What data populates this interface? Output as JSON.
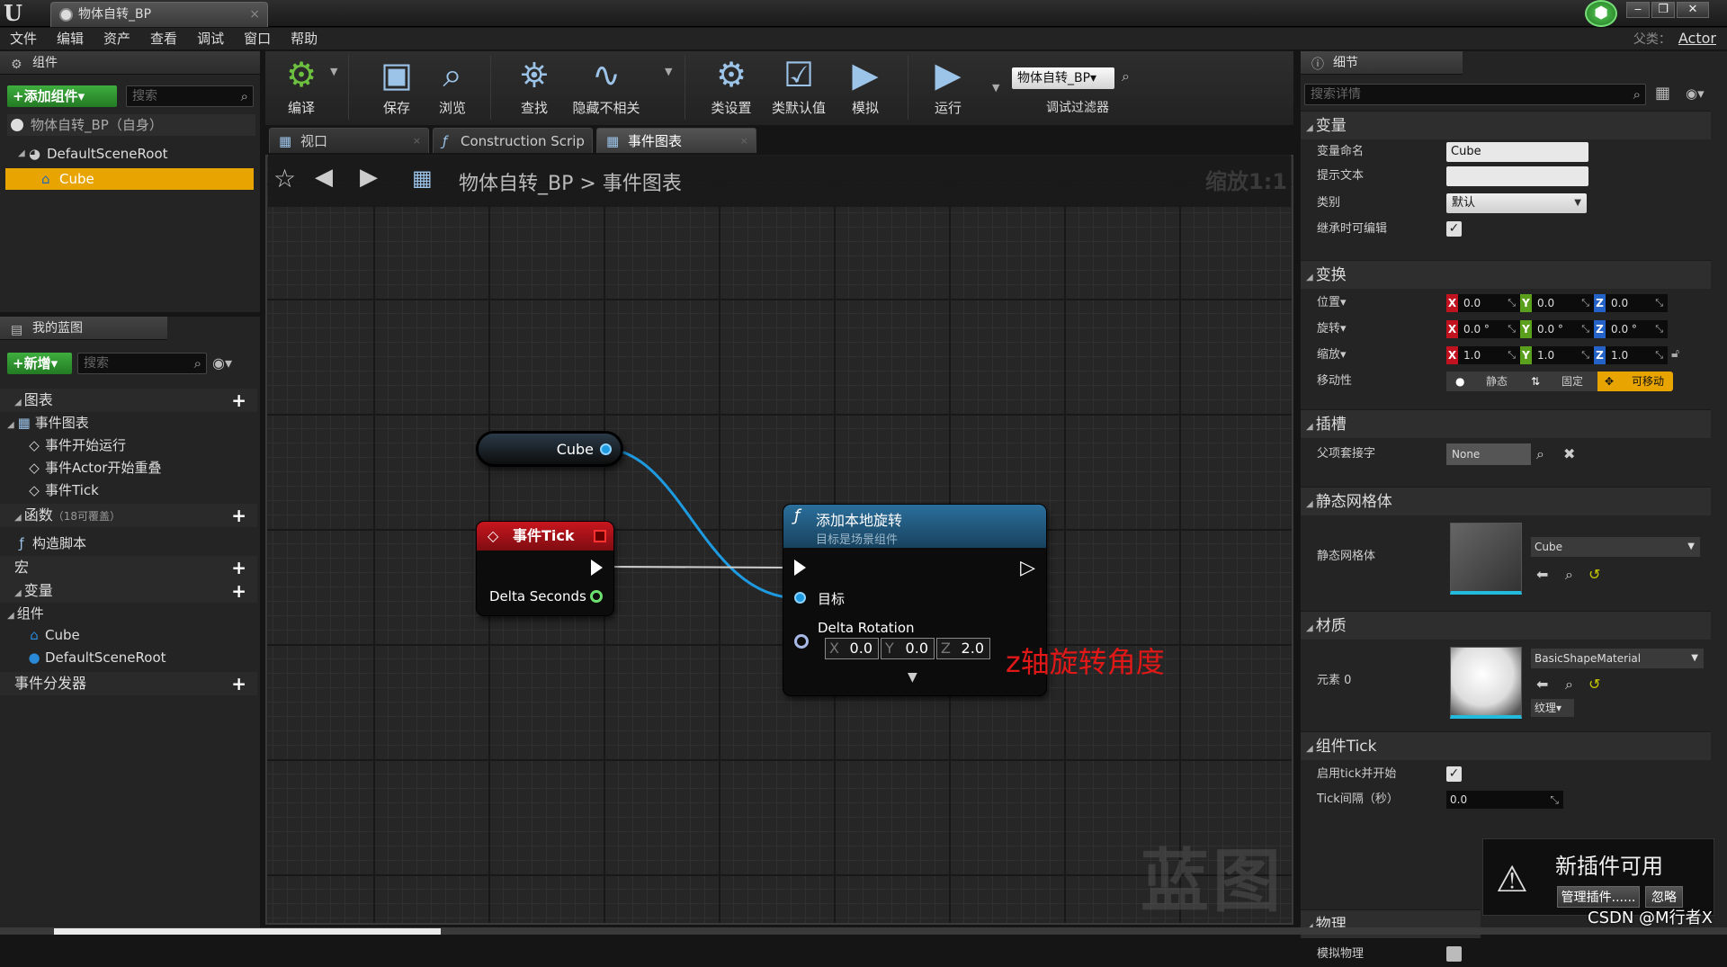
{
  "window": {
    "tab_title": "物体自转_BP",
    "tab_close": "×",
    "logo": "U",
    "min": "‒",
    "max": "❐",
    "close": "✕",
    "shield_icon": "shield-icon"
  },
  "menu": [
    "文件",
    "编辑",
    "资产",
    "查看",
    "调试",
    "窗口",
    "帮助"
  ],
  "parent_class": {
    "label": "父类：",
    "value": "Actor"
  },
  "components_panel": {
    "title": "组件",
    "add_button": "+添加组件▾",
    "search_placeholder": "搜索",
    "self_item": "物体自转_BP（自身）",
    "root_item": "DefaultSceneRoot",
    "selected_item": "Cube"
  },
  "my_blueprint_panel": {
    "title": "我的蓝图",
    "new_button": "+新增▾",
    "search_placeholder": "搜索",
    "graphs_header": "图表",
    "event_graph": "事件图表",
    "events": [
      "事件开始运行",
      "事件Actor开始重叠",
      "事件Tick"
    ],
    "functions_header": "函数",
    "functions_note": "（18可覆盖）",
    "construction_script": "构造脚本",
    "macros_header": "宏",
    "variables_header": "变量",
    "components_group": "组件",
    "variables": [
      "Cube",
      "DefaultSceneRoot"
    ],
    "dispatchers_header": "事件分发器"
  },
  "toolbar": {
    "compile": "编译",
    "save": "保存",
    "browse": "浏览",
    "find": "查找",
    "hide_unrelated": "隐藏不相关",
    "class_settings": "类设置",
    "class_defaults": "类默认值",
    "simulate": "模拟",
    "play": "运行",
    "debug_object": "物体自转_BP▾",
    "debug_filter": "调试过滤器"
  },
  "graph_tabs": [
    "视口",
    "Construction Scrip",
    "事件图表"
  ],
  "graph": {
    "breadcrumb_bp": "物体自转_BP",
    "breadcrumb_sep": ">",
    "breadcrumb_graph": "事件图表",
    "zoom": "缩放1:1",
    "watermark": "蓝图",
    "cube_node": "Cube",
    "tick_node_title": "事件Tick",
    "tick_delta": "Delta Seconds",
    "rot_node_title": "添加本地旋转",
    "rot_node_subtitle": "目标是场景组件",
    "target_pin": "目标",
    "delta_rotation": "Delta Rotation",
    "rot_x": "0.0",
    "rot_y": "0.0",
    "rot_z": "2.0",
    "annotation": "z轴旋转角度"
  },
  "details": {
    "title": "细节",
    "search_placeholder": "搜索详情",
    "variables_section": "变量",
    "var_name_label": "变量命名",
    "var_name_value": "Cube",
    "tooltip_label": "提示文本",
    "category_label": "类别",
    "category_value": "默认",
    "editable_label": "继承时可编辑",
    "transform_section": "变换",
    "location_label": "位置▾",
    "rotation_label": "旋转▾",
    "scale_label": "缩放▾",
    "loc": [
      "0.0",
      "0.0",
      "0.0"
    ],
    "rot": [
      "0.0 °",
      "0.0 °",
      "0.0 °"
    ],
    "scl": [
      "1.0",
      "1.0",
      "1.0"
    ],
    "mobility_label": "移动性",
    "mobility_static": "静态",
    "mobility_stationary": "固定",
    "mobility_movable": "可移动",
    "sockets_section": "插槽",
    "parent_socket_label": "父项套接字",
    "parent_socket_value": "None",
    "static_mesh_section": "静态网格体",
    "static_mesh_label": "静态网格体",
    "static_mesh_value": "Cube",
    "materials_section": "材质",
    "element0_label": "元素 0",
    "material_value": "BasicShapeMaterial",
    "texture_button": "纹理▾",
    "tick_section": "组件Tick",
    "tick_start_label": "启用tick并开始",
    "tick_interval_label": "Tick间隔（秒）",
    "tick_interval_value": "0.0",
    "physics_section": "物理",
    "simulate_physics_label": "模拟物理"
  },
  "notification": {
    "title": "新插件可用",
    "manage": "管理插件......",
    "ignore": "忽略"
  },
  "watermark_csdn": "CSDN @M行者X",
  "colors": {
    "accent_orange": "#e8a400",
    "pin_blue": "#1e9ae0",
    "tick_red": "#b3131a",
    "annotation_red": "#e01818"
  }
}
